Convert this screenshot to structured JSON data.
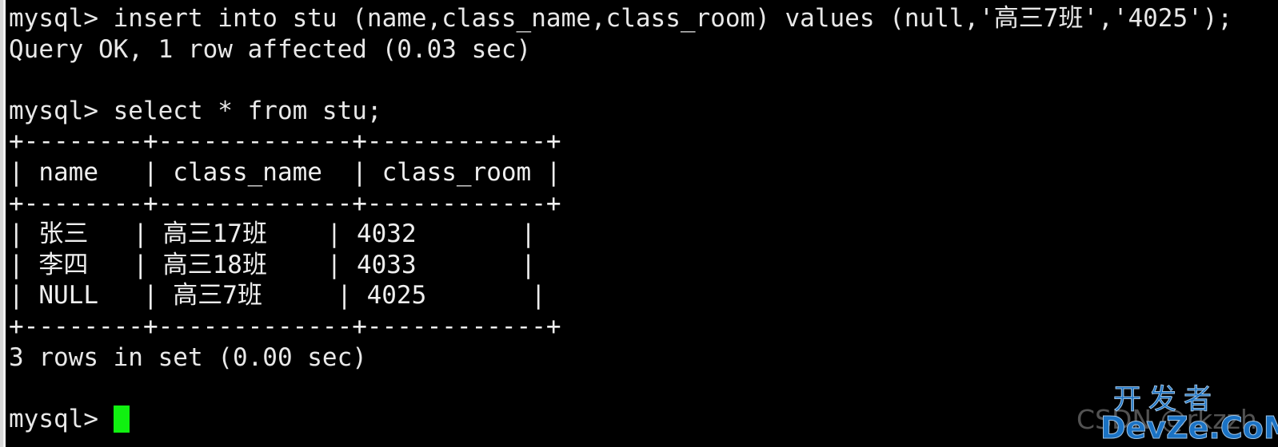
{
  "terminal": {
    "prompt": "mysql>",
    "background_color": "#000000",
    "text_color": "#e8e8e8",
    "cursor_color": "#10f110",
    "lines": [
      "mysql> insert into stu (name,class_name,class_room) values (null,'高三7班','4025');",
      "Query OK, 1 row affected (0.03 sec)",
      "",
      "mysql> select * from stu;",
      "+--------+-------------+------------+",
      "| name   | class_name  | class_room |",
      "+--------+-------------+------------+",
      "| 张三   | 高三17班    | 4032       |",
      "| 李四   | 高三18班    | 4033       |",
      "| NULL   | 高三7班     | 4025       |",
      "+--------+-------------+------------+",
      "3 rows in set (0.00 sec)",
      "",
      "mysql> "
    ],
    "commands": {
      "insert_statement": "insert into stu (name,class_name,class_room) values (null,'高三7班','4025');",
      "insert_result": "Query OK, 1 row affected (0.03 sec)",
      "select_statement": "select * from stu;",
      "select_result": "3 rows in set (0.00 sec)"
    },
    "result_table": {
      "columns": [
        "name",
        "class_name",
        "class_room"
      ],
      "rows": [
        [
          "张三",
          "高三17班",
          "4032"
        ],
        [
          "李四",
          "高三18班",
          "4033"
        ],
        [
          "NULL",
          "高三7班",
          "4025"
        ]
      ],
      "separator": "+--------+-------------+------------+",
      "header_row": "| name   | class_name  | class_room |",
      "row_strings": [
        "| 张三   | 高三17班    | 4032       |",
        "| 李四   | 高三18班    | 4033       |",
        "| NULL   | 高三7班     | 4025       |"
      ],
      "row_count_text": "3 rows in set (0.00 sec)"
    }
  },
  "watermark": {
    "ghost_text": "CSDN @rkzzh",
    "chinese_text": "开发者",
    "english_text": "DevZe.CoM",
    "color": "#1a72c4"
  }
}
